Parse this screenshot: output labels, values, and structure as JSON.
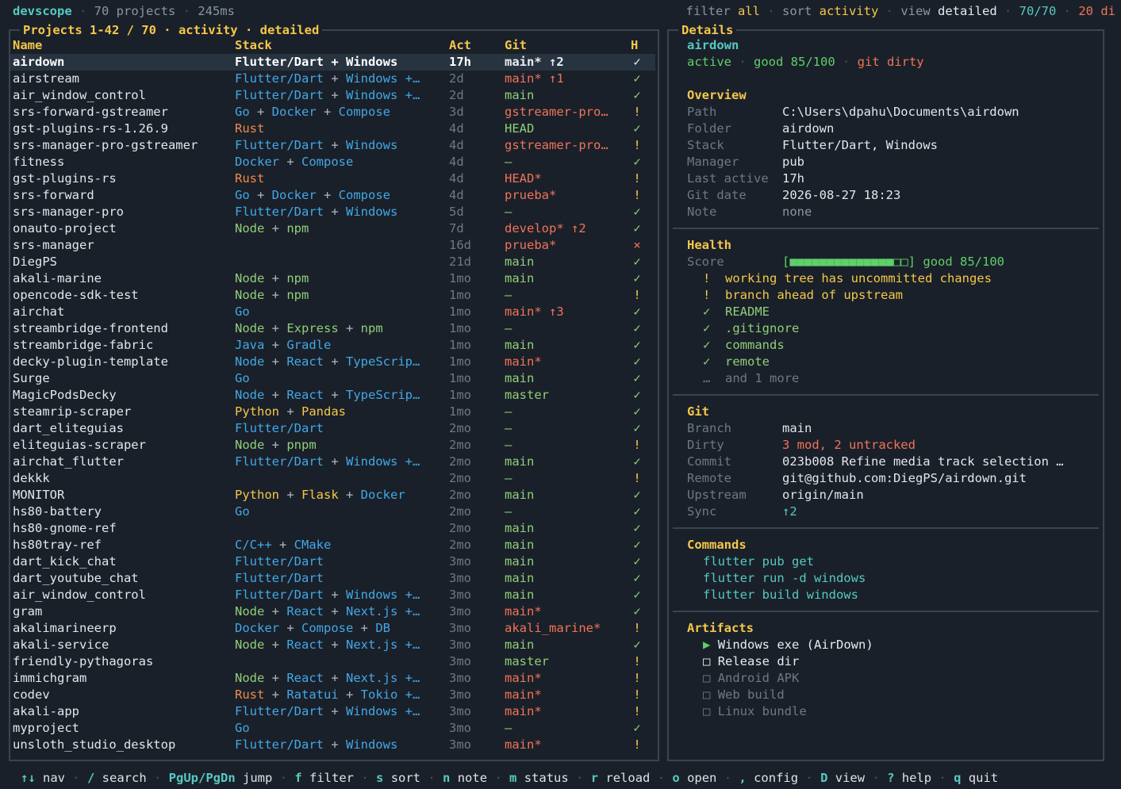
{
  "topbar": {
    "app_name": "devscope",
    "projects_count": "70 projects",
    "elapsed": "245ms",
    "filter_label": "filter",
    "filter_value": "all",
    "sort_label": "sort",
    "sort_value": "activity",
    "view_label": "view",
    "view_value": "detailed",
    "shown_ratio": "70/70",
    "dirty_count": "20 di"
  },
  "projects_panel": {
    "title": "Projects 1-42 / 70 · activity · detailed",
    "columns": {
      "name": "Name",
      "stack": "Stack",
      "act": "Act",
      "git": "Git",
      "h": "H"
    }
  },
  "colors": {
    "teal": "#56c9c2",
    "yellow": "#f5c74b",
    "blue": "#41a8e8",
    "green": "#8fcf7a",
    "orange": "#f08a4b",
    "red": "#f0735a",
    "gray": "#8a95a3"
  },
  "projects": [
    {
      "name": "airdown",
      "stack": [
        [
          "Flutter/Dart",
          "w"
        ],
        [
          "Windows",
          "w"
        ]
      ],
      "act": "17h",
      "git": "main* ↑2",
      "git_color": "white",
      "health": "✓",
      "health_color": "white",
      "selected": true
    },
    {
      "name": "airstream",
      "stack": [
        [
          "Flutter/Dart",
          "blue"
        ],
        [
          "Windows +…",
          "blue"
        ]
      ],
      "act": "2d",
      "git": "main* ↑1",
      "git_color": "red",
      "health": "✓",
      "health_color": "green"
    },
    {
      "name": "air_window_control",
      "stack": [
        [
          "Flutter/Dart",
          "blue"
        ],
        [
          "Windows +…",
          "blue"
        ]
      ],
      "act": "2d",
      "git": "main",
      "git_color": "green",
      "health": "✓",
      "health_color": "green"
    },
    {
      "name": "srs-forward-gstreamer",
      "stack": [
        [
          "Go",
          "blue"
        ],
        [
          "Docker",
          "blue"
        ],
        [
          "Compose",
          "blue"
        ]
      ],
      "act": "3d",
      "git": "gstreamer-pro…",
      "git_color": "red",
      "health": "!",
      "health_color": "yellow"
    },
    {
      "name": "gst-plugins-rs-1.26.9",
      "stack": [
        [
          "Rust",
          "orange"
        ]
      ],
      "act": "4d",
      "git": "HEAD",
      "git_color": "green",
      "health": "✓",
      "health_color": "green"
    },
    {
      "name": "srs-manager-pro-gstreamer",
      "stack": [
        [
          "Flutter/Dart",
          "blue"
        ],
        [
          "Windows",
          "blue"
        ]
      ],
      "act": "4d",
      "git": "gstreamer-pro…",
      "git_color": "red",
      "health": "!",
      "health_color": "yellow"
    },
    {
      "name": "fitness",
      "stack": [
        [
          "Docker",
          "blue"
        ],
        [
          "Compose",
          "blue"
        ]
      ],
      "act": "4d",
      "git": "—",
      "git_color": "green",
      "health": "✓",
      "health_color": "green"
    },
    {
      "name": "gst-plugins-rs",
      "stack": [
        [
          "Rust",
          "orange"
        ]
      ],
      "act": "4d",
      "git": "HEAD*",
      "git_color": "red",
      "health": "!",
      "health_color": "yellow"
    },
    {
      "name": "srs-forward",
      "stack": [
        [
          "Go",
          "blue"
        ],
        [
          "Docker",
          "blue"
        ],
        [
          "Compose",
          "blue"
        ]
      ],
      "act": "4d",
      "git": "prueba*",
      "git_color": "red",
      "health": "!",
      "health_color": "yellow"
    },
    {
      "name": "srs-manager-pro",
      "stack": [
        [
          "Flutter/Dart",
          "blue"
        ],
        [
          "Windows",
          "blue"
        ]
      ],
      "act": "5d",
      "git": "—",
      "git_color": "green",
      "health": "✓",
      "health_color": "green"
    },
    {
      "name": "onauto-project",
      "stack": [
        [
          "Node",
          "green"
        ],
        [
          "npm",
          "green"
        ]
      ],
      "act": "7d",
      "git": "develop* ↑2",
      "git_color": "red",
      "health": "✓",
      "health_color": "green"
    },
    {
      "name": "srs-manager",
      "stack": [],
      "act": "16d",
      "git": "prueba*",
      "git_color": "red",
      "health": "×",
      "health_color": "red"
    },
    {
      "name": "DiegPS",
      "stack": [],
      "act": "21d",
      "git": "main",
      "git_color": "green",
      "health": "✓",
      "health_color": "green"
    },
    {
      "name": "akali-marine",
      "stack": [
        [
          "Node",
          "green"
        ],
        [
          "npm",
          "green"
        ]
      ],
      "act": "1mo",
      "git": "main",
      "git_color": "green",
      "health": "✓",
      "health_color": "green"
    },
    {
      "name": "opencode-sdk-test",
      "stack": [
        [
          "Node",
          "green"
        ],
        [
          "npm",
          "green"
        ]
      ],
      "act": "1mo",
      "git": "—",
      "git_color": "green",
      "health": "!",
      "health_color": "yellow"
    },
    {
      "name": "airchat",
      "stack": [
        [
          "Go",
          "blue"
        ]
      ],
      "act": "1mo",
      "git": "main* ↑3",
      "git_color": "red",
      "health": "✓",
      "health_color": "green"
    },
    {
      "name": "streambridge-frontend",
      "stack": [
        [
          "Node",
          "green"
        ],
        [
          "Express",
          "green"
        ],
        [
          "npm",
          "green"
        ]
      ],
      "act": "1mo",
      "git": "—",
      "git_color": "green",
      "health": "✓",
      "health_color": "green"
    },
    {
      "name": "streambridge-fabric",
      "stack": [
        [
          "Java",
          "blue"
        ],
        [
          "Gradle",
          "blue"
        ]
      ],
      "act": "1mo",
      "git": "main",
      "git_color": "green",
      "health": "✓",
      "health_color": "green"
    },
    {
      "name": "decky-plugin-template",
      "stack": [
        [
          "Node",
          "blue"
        ],
        [
          "React",
          "blue"
        ],
        [
          "TypeScrip…",
          "blue"
        ]
      ],
      "act": "1mo",
      "git": "main*",
      "git_color": "red",
      "health": "✓",
      "health_color": "green"
    },
    {
      "name": "Surge",
      "stack": [
        [
          "Go",
          "blue"
        ]
      ],
      "act": "1mo",
      "git": "main",
      "git_color": "green",
      "health": "✓",
      "health_color": "green"
    },
    {
      "name": "MagicPodsDecky",
      "stack": [
        [
          "Node",
          "blue"
        ],
        [
          "React",
          "blue"
        ],
        [
          "TypeScrip…",
          "blue"
        ]
      ],
      "act": "1mo",
      "git": "master",
      "git_color": "green",
      "health": "✓",
      "health_color": "green"
    },
    {
      "name": "steamrip-scraper",
      "stack": [
        [
          "Python",
          "yellow"
        ],
        [
          "Pandas",
          "yellow"
        ]
      ],
      "act": "1mo",
      "git": "—",
      "git_color": "green",
      "health": "✓",
      "health_color": "green"
    },
    {
      "name": "dart_eliteguias",
      "stack": [
        [
          "Flutter/Dart",
          "blue"
        ]
      ],
      "act": "2mo",
      "git": "—",
      "git_color": "green",
      "health": "✓",
      "health_color": "green"
    },
    {
      "name": "eliteguias-scraper",
      "stack": [
        [
          "Node",
          "green"
        ],
        [
          "pnpm",
          "green"
        ]
      ],
      "act": "2mo",
      "git": "—",
      "git_color": "green",
      "health": "!",
      "health_color": "yellow"
    },
    {
      "name": "airchat_flutter",
      "stack": [
        [
          "Flutter/Dart",
          "blue"
        ],
        [
          "Windows +…",
          "blue"
        ]
      ],
      "act": "2mo",
      "git": "main",
      "git_color": "green",
      "health": "✓",
      "health_color": "green"
    },
    {
      "name": "dekkk",
      "stack": [],
      "act": "2mo",
      "git": "—",
      "git_color": "green",
      "health": "!",
      "health_color": "yellow"
    },
    {
      "name": "MONITOR",
      "stack": [
        [
          "Python",
          "yellow"
        ],
        [
          "Flask",
          "yellow"
        ],
        [
          "Docker",
          "blue"
        ]
      ],
      "act": "2mo",
      "git": "main",
      "git_color": "green",
      "health": "✓",
      "health_color": "green"
    },
    {
      "name": "hs80-battery",
      "stack": [
        [
          "Go",
          "blue"
        ]
      ],
      "act": "2mo",
      "git": "—",
      "git_color": "green",
      "health": "✓",
      "health_color": "green"
    },
    {
      "name": "hs80-gnome-ref",
      "stack": [],
      "act": "2mo",
      "git": "main",
      "git_color": "green",
      "health": "✓",
      "health_color": "green"
    },
    {
      "name": "hs80tray-ref",
      "stack": [
        [
          "C/C++",
          "blue"
        ],
        [
          "CMake",
          "blue"
        ]
      ],
      "act": "2mo",
      "git": "main",
      "git_color": "green",
      "health": "✓",
      "health_color": "green"
    },
    {
      "name": "dart_kick_chat",
      "stack": [
        [
          "Flutter/Dart",
          "blue"
        ]
      ],
      "act": "3mo",
      "git": "main",
      "git_color": "green",
      "health": "✓",
      "health_color": "green"
    },
    {
      "name": "dart_youtube_chat",
      "stack": [
        [
          "Flutter/Dart",
          "blue"
        ]
      ],
      "act": "3mo",
      "git": "main",
      "git_color": "green",
      "health": "✓",
      "health_color": "green"
    },
    {
      "name": "air_window_control",
      "stack": [
        [
          "Flutter/Dart",
          "blue"
        ],
        [
          "Windows +…",
          "blue"
        ]
      ],
      "act": "3mo",
      "git": "main",
      "git_color": "green",
      "health": "✓",
      "health_color": "green"
    },
    {
      "name": "gram",
      "stack": [
        [
          "Node",
          "green"
        ],
        [
          "React",
          "blue"
        ],
        [
          "Next.js +…",
          "blue"
        ]
      ],
      "act": "3mo",
      "git": "main*",
      "git_color": "red",
      "health": "✓",
      "health_color": "green"
    },
    {
      "name": "akalimarineerp",
      "stack": [
        [
          "Docker",
          "blue"
        ],
        [
          "Compose",
          "blue"
        ],
        [
          "DB",
          "blue"
        ]
      ],
      "act": "3mo",
      "git": "akali_marine*",
      "git_color": "red",
      "health": "!",
      "health_color": "yellow"
    },
    {
      "name": "akali-service",
      "stack": [
        [
          "Node",
          "green"
        ],
        [
          "React",
          "blue"
        ],
        [
          "Next.js +…",
          "blue"
        ]
      ],
      "act": "3mo",
      "git": "main",
      "git_color": "green",
      "health": "✓",
      "health_color": "green"
    },
    {
      "name": "friendly-pythagoras",
      "stack": [],
      "act": "3mo",
      "git": "master",
      "git_color": "green",
      "health": "!",
      "health_color": "yellow"
    },
    {
      "name": "immichgram",
      "stack": [
        [
          "Node",
          "green"
        ],
        [
          "React",
          "blue"
        ],
        [
          "Next.js +…",
          "blue"
        ]
      ],
      "act": "3mo",
      "git": "main*",
      "git_color": "red",
      "health": "!",
      "health_color": "yellow"
    },
    {
      "name": "codev",
      "stack": [
        [
          "Rust",
          "orange"
        ],
        [
          "Ratatui",
          "blue"
        ],
        [
          "Tokio +…",
          "blue"
        ]
      ],
      "act": "3mo",
      "git": "main*",
      "git_color": "red",
      "health": "!",
      "health_color": "yellow"
    },
    {
      "name": "akali-app",
      "stack": [
        [
          "Flutter/Dart",
          "blue"
        ],
        [
          "Windows +…",
          "blue"
        ]
      ],
      "act": "3mo",
      "git": "main*",
      "git_color": "red",
      "health": "!",
      "health_color": "yellow"
    },
    {
      "name": "myproject",
      "stack": [
        [
          "Go",
          "blue"
        ]
      ],
      "act": "3mo",
      "git": "—",
      "git_color": "green",
      "health": "✓",
      "health_color": "green"
    },
    {
      "name": "unsloth_studio_desktop",
      "stack": [
        [
          "Flutter/Dart",
          "blue"
        ],
        [
          "Windows",
          "blue"
        ]
      ],
      "act": "3mo",
      "git": "main*",
      "git_color": "red",
      "health": "!",
      "health_color": "yellow"
    }
  ],
  "details": {
    "panel_title": "Details",
    "project_name": "airdown",
    "status_active": "active",
    "status_good": "good 85/100",
    "status_git": "git dirty",
    "overview": {
      "title": "Overview",
      "rows": [
        {
          "key": "Path",
          "value": "C:\\Users\\dpahu\\Documents\\airdown",
          "color": "white"
        },
        {
          "key": "Folder",
          "value": "airdown",
          "color": "white"
        },
        {
          "key": "Stack",
          "value": "Flutter/Dart, Windows",
          "color": "white"
        },
        {
          "key": "Manager",
          "value": "pub",
          "color": "white"
        },
        {
          "key": "Last active",
          "value": "17h",
          "color": "white"
        },
        {
          "key": "Git date",
          "value": "2026-08-27 18:23",
          "color": "white"
        },
        {
          "key": "Note",
          "value": "none",
          "color": "dim"
        }
      ]
    },
    "health": {
      "title": "Health",
      "score_label": "Score",
      "score_fraction": 0.85,
      "score_text": "good 85/100",
      "items": [
        {
          "mark": "!",
          "text": "working tree has uncommitted changes",
          "color": "yellow"
        },
        {
          "mark": "!",
          "text": "branch ahead of upstream",
          "color": "yellow"
        },
        {
          "mark": "✓",
          "text": "README",
          "color": "green"
        },
        {
          "mark": "✓",
          "text": ".gitignore",
          "color": "green"
        },
        {
          "mark": "✓",
          "text": "commands",
          "color": "green"
        },
        {
          "mark": "✓",
          "text": "remote",
          "color": "green"
        },
        {
          "mark": "…",
          "text": "and 1 more",
          "color": "dim"
        }
      ]
    },
    "git": {
      "title": "Git",
      "rows": [
        {
          "key": "Branch",
          "value": "main",
          "color": "white"
        },
        {
          "key": "Dirty",
          "value": "3 mod, 2 untracked",
          "color": "red"
        },
        {
          "key": "Commit",
          "value": "023b008 Refine media track selection …",
          "color": "white"
        },
        {
          "key": "Remote",
          "value": "git@github.com:DiegPS/airdown.git",
          "color": "white"
        },
        {
          "key": "Upstream",
          "value": "origin/main",
          "color": "white"
        },
        {
          "key": "Sync",
          "value": "↑2",
          "color": "teal"
        }
      ]
    },
    "commands": {
      "title": "Commands",
      "items": [
        "flutter pub get",
        "flutter run -d windows",
        "flutter build windows"
      ]
    },
    "artifacts": {
      "title": "Artifacts",
      "items": [
        {
          "mark": "▶",
          "text": "Windows exe (AirDown)",
          "active": true,
          "mark_color": "green"
        },
        {
          "mark": "□",
          "text": "Release dir",
          "active": true,
          "mark_color": "white"
        },
        {
          "mark": "□",
          "text": "Android APK",
          "active": false
        },
        {
          "mark": "□",
          "text": "Web build",
          "active": false
        },
        {
          "mark": "□",
          "text": "Linux bundle",
          "active": false
        }
      ]
    }
  },
  "bottombar": [
    {
      "key": "↑↓",
      "label": "nav"
    },
    {
      "key": "/",
      "label": "search"
    },
    {
      "key": "PgUp/PgDn",
      "label": "jump"
    },
    {
      "key": "f",
      "label": "filter"
    },
    {
      "key": "s",
      "label": "sort"
    },
    {
      "key": "n",
      "label": "note"
    },
    {
      "key": "m",
      "label": "status"
    },
    {
      "key": "r",
      "label": "reload"
    },
    {
      "key": "o",
      "label": "open"
    },
    {
      "key": ",",
      "label": "config"
    },
    {
      "key": "D",
      "label": "view"
    },
    {
      "key": "?",
      "label": "help"
    },
    {
      "key": "q",
      "label": "quit"
    }
  ]
}
